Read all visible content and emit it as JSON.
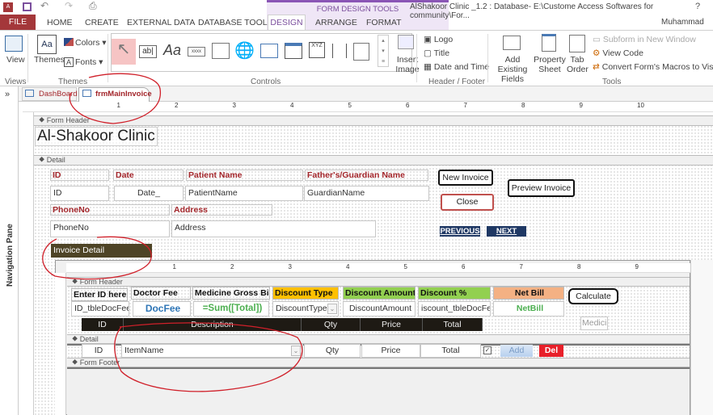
{
  "titlebar": {
    "title": "AlShakoor Clinic _1.2 : Database- E:\\Custome Access Softwares for community\\For...",
    "contextual_group": "FORM DESIGN TOOLS",
    "help": "?",
    "user": "Muhammad"
  },
  "tabs": [
    "FILE",
    "HOME",
    "CREATE",
    "EXTERNAL DATA",
    "DATABASE TOOLS",
    "DESIGN",
    "ARRANGE",
    "FORMAT"
  ],
  "ribbon": {
    "view": "View",
    "themes": "Themes",
    "colors": "Colors",
    "fonts": "Fonts",
    "textbox_glyph": "ab|",
    "label_glyph": "Aa",
    "button_glyph": "xxxx",
    "xyz_glyph": "XYZ",
    "insert_image": "Insert Image",
    "logo": "Logo",
    "title": "Title",
    "date_time": "Date and Time",
    "add_fields": "Add Existing Fields",
    "property_sheet": "Property Sheet",
    "tab_order": "Tab Order",
    "subform_window": "Subform in New Window",
    "view_code": "View Code",
    "convert_macros": "Convert Form's Macros to Visual B",
    "groups": {
      "views": "Views",
      "themes": "Themes",
      "controls": "Controls",
      "header_footer": "Header / Footer",
      "tools": "Tools"
    }
  },
  "nav": {
    "expand": "»",
    "label": "Navigation Pane"
  },
  "doc_tabs": [
    "DashBoard",
    "frmMainInvoice"
  ],
  "ruler": [
    "1",
    "2",
    "3",
    "4",
    "5",
    "6",
    "7",
    "8",
    "9",
    "10"
  ],
  "form": {
    "sections": {
      "header": "Form Header",
      "detail": "Detail",
      "footer": "Form Footer"
    },
    "title": "Al-Shakoor Clinic",
    "labels": {
      "id": "ID",
      "date": "Date",
      "patient": "Patient Name",
      "guardian": "Father's/Guardian Name",
      "phone": "PhoneNo",
      "address": "Address",
      "invoice_detail": "Invoice Detail"
    },
    "fields": {
      "id": "ID",
      "date": "Date_",
      "patient": "PatientName",
      "guardian": "GuardianName",
      "phone": "PhoneNo",
      "address": "Address"
    },
    "buttons": {
      "new_invoice": "New Invoice",
      "close": "Close",
      "preview": "Preview Invoice",
      "previous": "PREVIOUS",
      "next": "NEXT"
    }
  },
  "subform": {
    "header_labels": [
      "Enter ID here",
      "Doctor Fee",
      "Medicine Gross Bill",
      "Discount Type",
      "Discount Amount",
      "Discount %",
      "Net Bill"
    ],
    "header_fields": [
      "ID_tbleDocFee",
      "DocFee",
      "=Sum([Total])",
      "DiscountType",
      "DiscountAmount",
      "iscount_tbleDocFe",
      "NetBill"
    ],
    "calculate": "Calculate",
    "medici": "Medici",
    "columns": [
      "ID",
      "Description",
      "Qty",
      "Price",
      "Total"
    ],
    "detail": {
      "id": "ID",
      "item": "ItemName",
      "qty": "Qty",
      "price": "Price",
      "total": "Total",
      "add": "Add",
      "del": "Del"
    }
  },
  "colors": {
    "file": "#a4373a",
    "label_red": "#a3262b",
    "discount_type": "#ffc000",
    "discount_green": "#92d050",
    "net_bill": "#f4b183",
    "nav_blue": "#1f3864",
    "invoice_detail": "#4e4426"
  }
}
